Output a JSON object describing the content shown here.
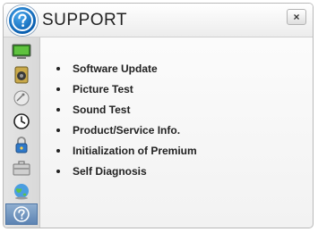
{
  "window": {
    "title": "SUPPORT",
    "close_label": "×"
  },
  "title_icon": "question-circle-icon",
  "sidebar": {
    "items": [
      {
        "icon": "monitor-icon",
        "active": false
      },
      {
        "icon": "speaker-icon",
        "active": false
      },
      {
        "icon": "satellite-dish-icon",
        "active": false
      },
      {
        "icon": "clock-icon",
        "active": false
      },
      {
        "icon": "lock-icon",
        "active": false
      },
      {
        "icon": "toolbox-icon",
        "active": false
      },
      {
        "icon": "globe-icon",
        "active": false
      },
      {
        "icon": "question-circle-icon",
        "active": true
      }
    ]
  },
  "menu": {
    "items": [
      {
        "label": "Software Update"
      },
      {
        "label": "Picture Test"
      },
      {
        "label": "Sound Test"
      },
      {
        "label": "Product/Service Info."
      },
      {
        "label": "Initialization of Premium"
      },
      {
        "label": "Self Diagnosis"
      }
    ]
  },
  "colors": {
    "accent": "#0a5fb0",
    "active_tab": "#5d84b3"
  }
}
